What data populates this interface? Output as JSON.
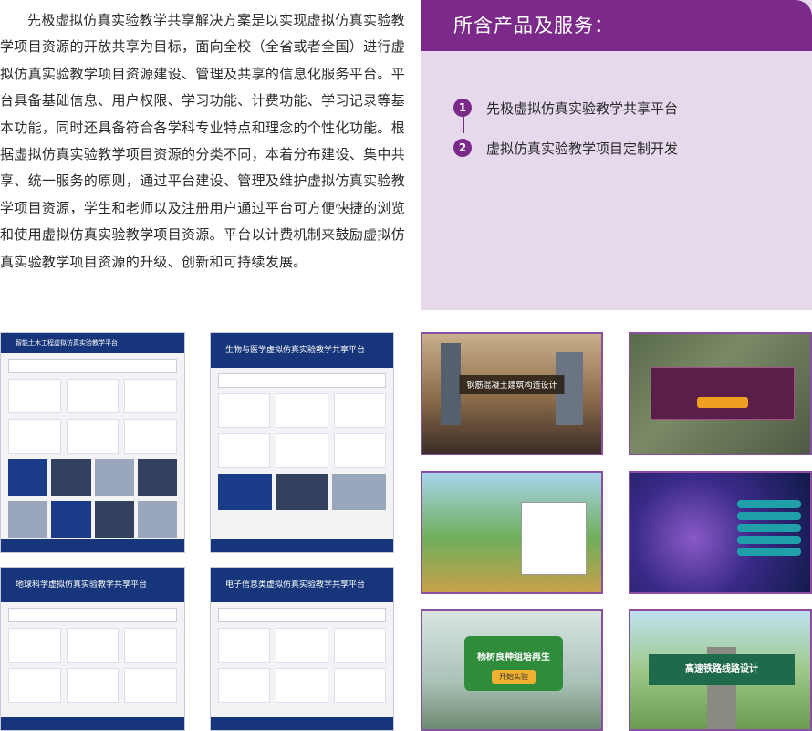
{
  "intro": {
    "text": "先极虚拟仿真实验教学共享解决方案是以实现虚拟仿真实验教学项目资源的开放共享为目标，面向全校（全省或者全国）进行虚拟仿真实验教学项目资源建设、管理及共享的信息化服务平台。平台具备基础信息、用户权限、学习功能、计费功能、学习记录等基本功能，同时还具备符合各学科专业特点和理念的个性化功能。根据虚拟仿真实验教学项目资源的分类不同，本着分布建设、集中共享、统一服务的原则，通过平台建设、管理及维护虚拟仿真实验教学项目资源，学生和老师以及注册用户通过平台可方便快捷的浏览和使用虚拟仿真实验教学项目资源。平台以计费机制来鼓励虚拟仿真实验教学项目资源的升级、创新和可持续发展。"
  },
  "panel": {
    "title": "所含产品及服务：",
    "items": [
      {
        "num": "1",
        "label": "先极虚拟仿真实验教学共享平台"
      },
      {
        "num": "2",
        "label": "虚拟仿真实验教学项目定制开发"
      }
    ]
  },
  "thumbs": {
    "site1": "智能土木工程虚拟仿真实验教学平台",
    "site2": "生物与医学虚拟仿真实验教学共享平台",
    "site3": "地球科学虚拟仿真实验教学共享平台",
    "site4": "电子信息类虚拟仿真实验教学共享平台",
    "game1": "钢筋混凝土建筑构造设计",
    "game5": "杨树良种组培再生",
    "game5_btn": "开始实验",
    "game6": "高速铁路线路设计"
  },
  "colors": {
    "accent": "#7b2a8a",
    "panel_bg": "#e6d9ec",
    "site_header": "#16357a"
  }
}
